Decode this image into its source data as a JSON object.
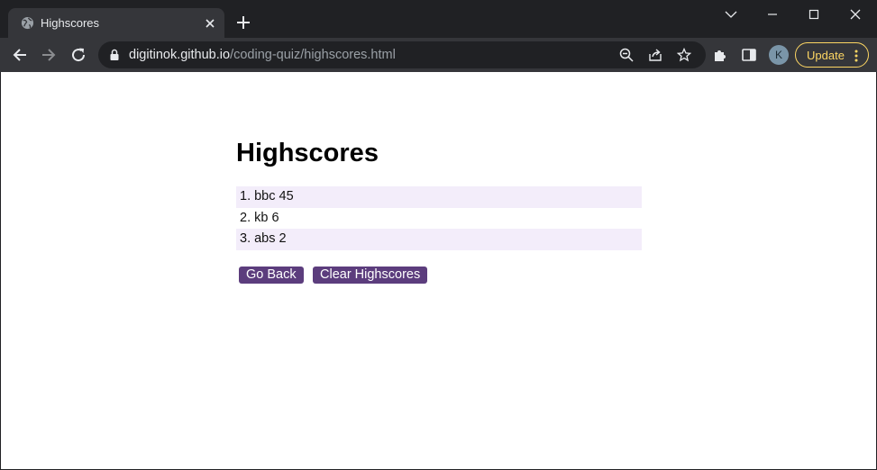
{
  "browser": {
    "tab_title": "Highscores",
    "url_host": "digitinok.github.io",
    "url_path": "/coding-quiz/highscores.html",
    "avatar_letter": "K",
    "update_label": "Update",
    "icons": [
      "globe-icon",
      "close-icon",
      "plus-icon",
      "chevron-down-icon",
      "minimize-icon",
      "maximize-icon",
      "window-close-icon",
      "back-arrow-icon",
      "forward-arrow-icon",
      "reload-icon",
      "lock-icon",
      "zoom-out-icon",
      "share-icon",
      "star-icon",
      "puzzle-icon",
      "side-panel-icon",
      "kebab-menu-icon"
    ]
  },
  "page": {
    "title": "Highscores",
    "scores": [
      {
        "text": "1. bbc 45"
      },
      {
        "text": "2. kb 6"
      },
      {
        "text": "3. abs 2"
      }
    ],
    "go_back_label": "Go Back",
    "clear_label": "Clear Highscores"
  },
  "colors": {
    "button_bg": "#5c3d7d",
    "list_shade": "#f3edfa",
    "update_accent": "#fdd663"
  }
}
